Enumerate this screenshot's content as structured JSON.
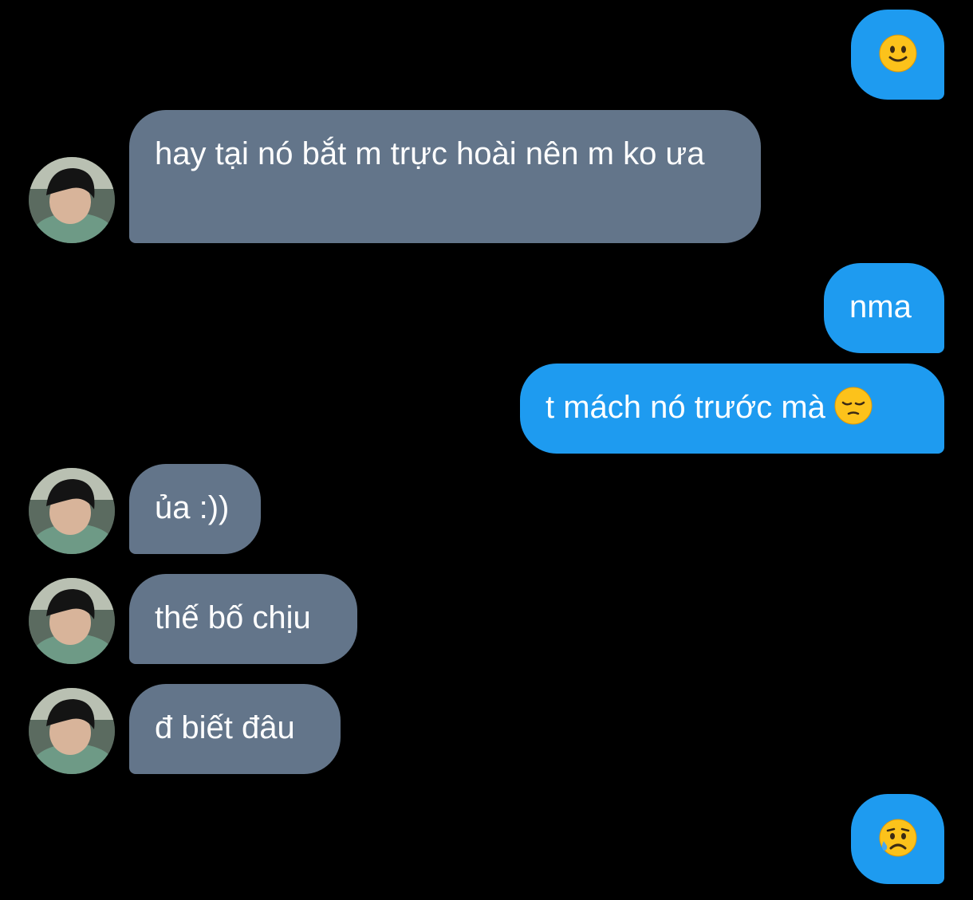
{
  "conversation": {
    "messages": [
      {
        "direction": "outgoing",
        "text": "",
        "emoji": "slightly-smiling-face"
      },
      {
        "direction": "incoming",
        "text": "hay tại nó bắt m trực hoài nên m ko ưa"
      },
      {
        "direction": "outgoing",
        "text": "nma"
      },
      {
        "direction": "outgoing",
        "text": "t mách nó trước mà",
        "emoji": "pensive-face"
      },
      {
        "direction": "incoming",
        "text": "ủa :))"
      },
      {
        "direction": "incoming",
        "text": "thế bố chịu"
      },
      {
        "direction": "incoming",
        "text": "đ biết đâu"
      },
      {
        "direction": "outgoing",
        "text": "",
        "emoji": "sad-but-relieved-face"
      }
    ]
  },
  "colors": {
    "background": "#000000",
    "outgoing_bubble": "#1e9bf0",
    "incoming_bubble": "#63758a",
    "text": "#ffffff"
  }
}
